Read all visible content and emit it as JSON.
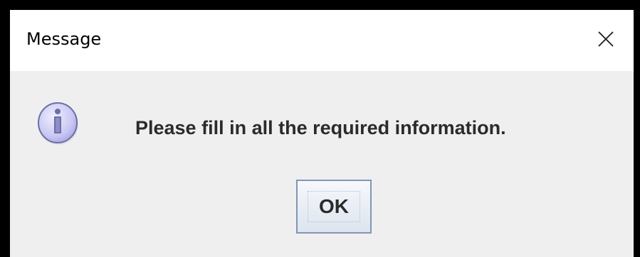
{
  "dialog": {
    "title": "Message",
    "message": "Please fill in all the required information.",
    "ok_label": "OK",
    "icon": "info-icon",
    "close_icon": "close-icon"
  },
  "colors": {
    "titlebar_bg": "#ffffff",
    "body_bg": "#efefef",
    "button_border": "#7f97b5",
    "icon_fill": "#c9c7f2",
    "icon_stroke": "#6b6fa8"
  }
}
